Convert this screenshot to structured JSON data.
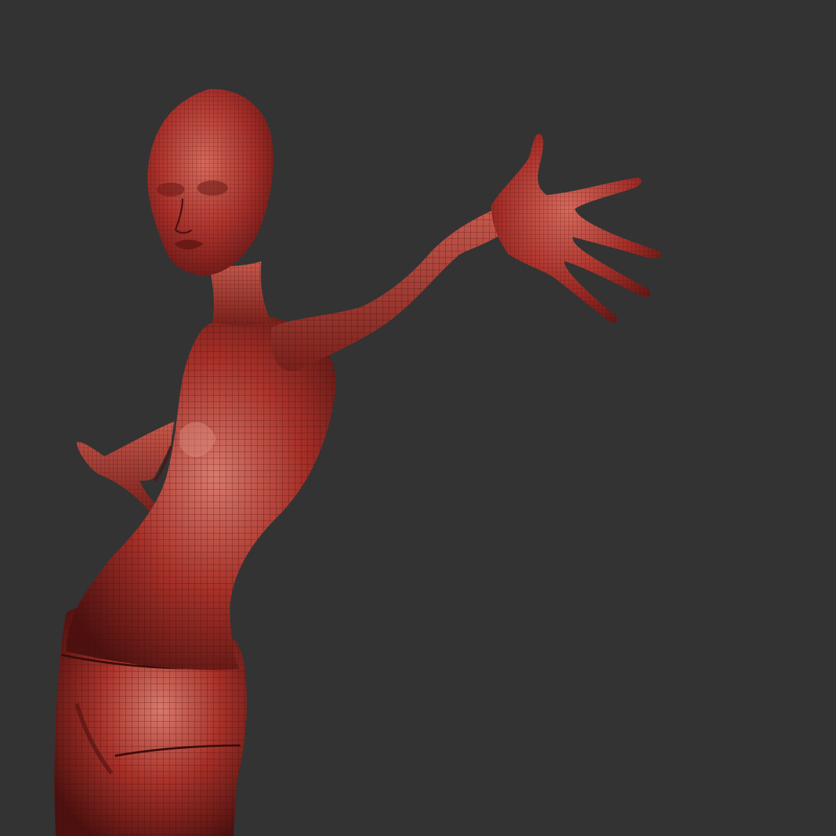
{
  "scene": {
    "subject": "3d-wireframe-figure",
    "background_color": "#333333",
    "mesh_colors": {
      "base": "#a8302a",
      "light": "#d96b5e",
      "shadow": "#5a1412",
      "wire": "#3a0c0a"
    }
  }
}
